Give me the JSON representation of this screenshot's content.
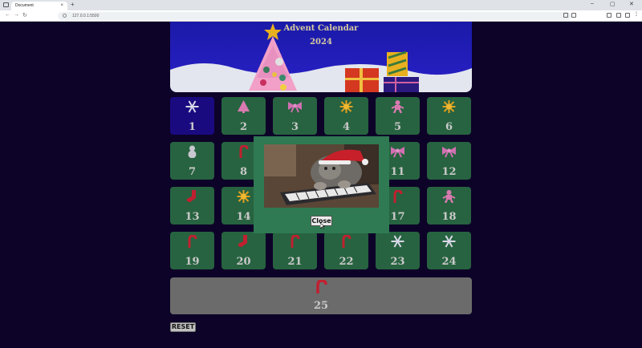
{
  "browser": {
    "tab_title": "Document",
    "tab_close": "×",
    "new_tab": "+",
    "url": "127.0.0.1:5500",
    "window_controls": [
      "–",
      "▢",
      "✕"
    ],
    "nav": [
      "←",
      "→",
      "↻"
    ]
  },
  "banner": {
    "title_line1": "Advent Calendar",
    "title_line2": "2024"
  },
  "days": [
    {
      "num": "1",
      "icon": "snowflake-icon",
      "opened": true
    },
    {
      "num": "2",
      "icon": "tree-icon"
    },
    {
      "num": "3",
      "icon": "bow-icon"
    },
    {
      "num": "4",
      "icon": "star-icon"
    },
    {
      "num": "5",
      "icon": "gingerbread-icon"
    },
    {
      "num": "6",
      "icon": "star-icon"
    },
    {
      "num": "7",
      "icon": "snowman-icon"
    },
    {
      "num": "8",
      "icon": "candy-cane-icon"
    },
    {
      "num": "11",
      "icon": "bow-icon"
    },
    {
      "num": "12",
      "icon": "bow-icon"
    },
    {
      "num": "13",
      "icon": "stocking-icon"
    },
    {
      "num": "14",
      "icon": "star-icon"
    },
    {
      "num": "17",
      "icon": "candy-cane-icon"
    },
    {
      "num": "18",
      "icon": "gingerbread-icon"
    },
    {
      "num": "19",
      "icon": "candy-cane-icon"
    },
    {
      "num": "20",
      "icon": "stocking-icon"
    },
    {
      "num": "21",
      "icon": "candy-cane-icon"
    },
    {
      "num": "22",
      "icon": "candy-cane-icon"
    },
    {
      "num": "23",
      "icon": "snowflake-icon"
    },
    {
      "num": "24",
      "icon": "snowflake-icon"
    }
  ],
  "day25": {
    "num": "25",
    "icon": "candy-cane-icon"
  },
  "reset_label": "RESET",
  "modal": {
    "media": "cat-in-santa-hat-playing-keyboard",
    "close_label": "Close"
  },
  "colors": {
    "page_bg": "#0d0228",
    "tile": "#276340",
    "tile_opened": "#1a0a80",
    "tile_25": "#6b6b6b",
    "modal_bg": "#2f7a52"
  }
}
